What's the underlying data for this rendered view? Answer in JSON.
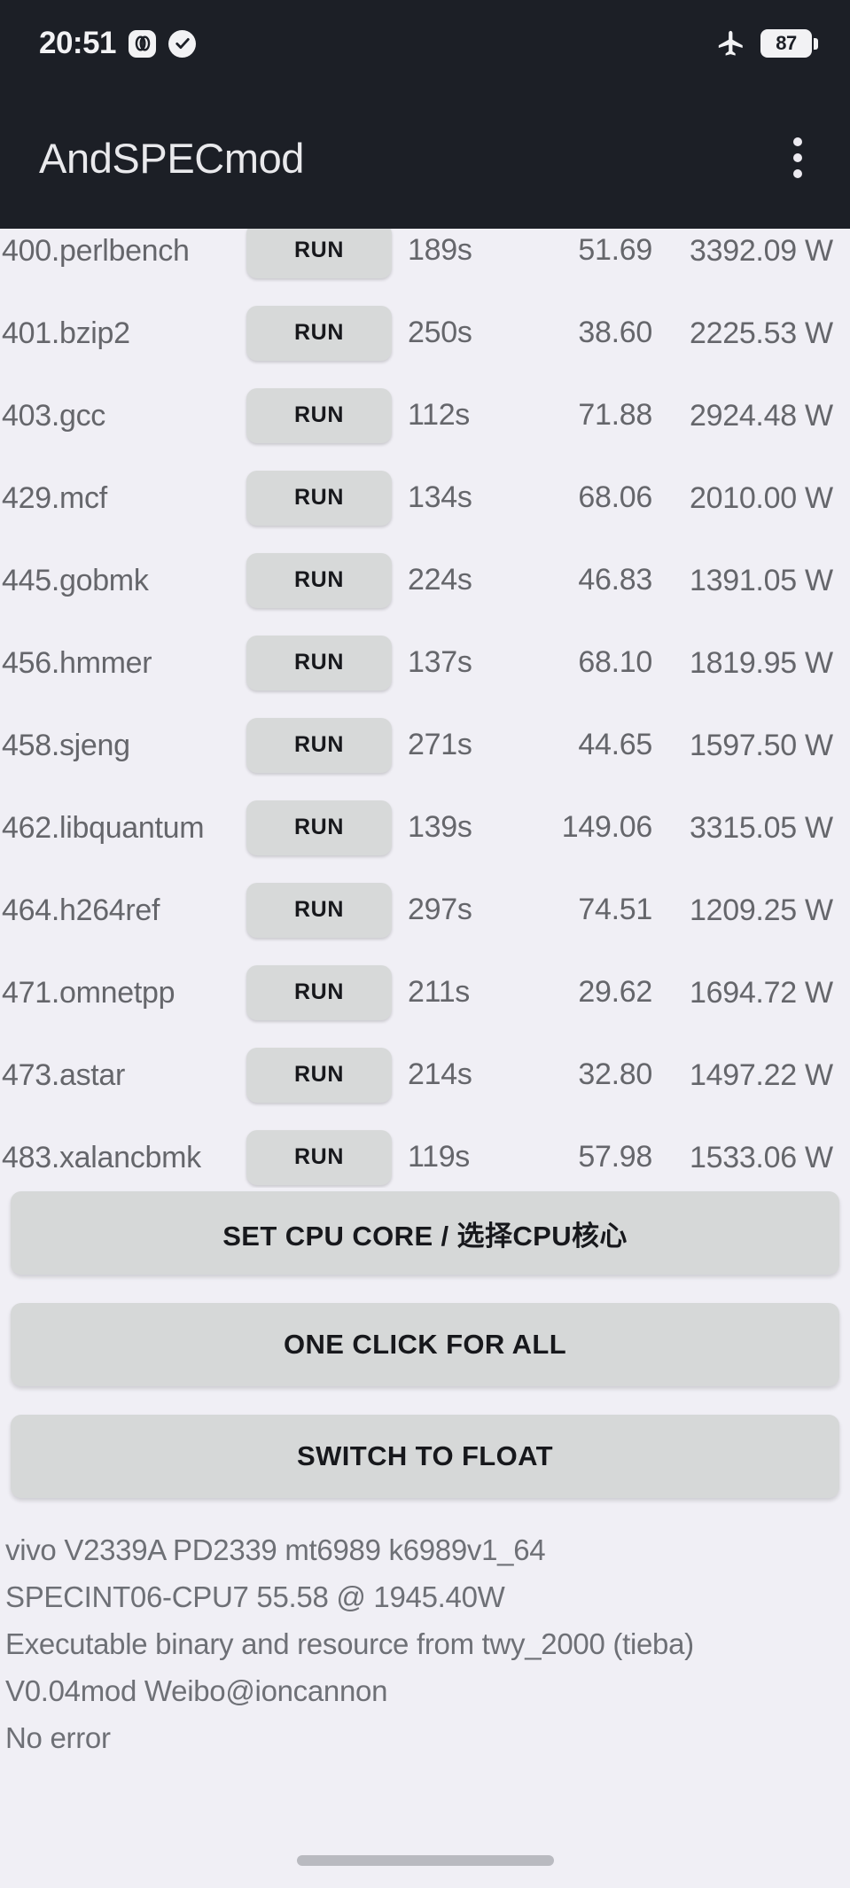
{
  "statusbar": {
    "time": "20:51",
    "icons": [
      "jovi-icon",
      "check-circle-icon",
      "airplane-mode-icon"
    ],
    "battery_level": "87"
  },
  "appbar": {
    "title": "AndSPECmod",
    "overflow_menu": "more-options-icon"
  },
  "table": {
    "run_label": "RUN",
    "rows": [
      {
        "name": "400.perlbench",
        "time": "189s",
        "score": "51.69",
        "power": "3392.09 W"
      },
      {
        "name": "401.bzip2",
        "time": "250s",
        "score": "38.60",
        "power": "2225.53 W"
      },
      {
        "name": "403.gcc",
        "time": "112s",
        "score": "71.88",
        "power": "2924.48 W"
      },
      {
        "name": "429.mcf",
        "time": "134s",
        "score": "68.06",
        "power": "2010.00 W"
      },
      {
        "name": "445.gobmk",
        "time": "224s",
        "score": "46.83",
        "power": "1391.05 W"
      },
      {
        "name": "456.hmmer",
        "time": "137s",
        "score": "68.10",
        "power": "1819.95 W"
      },
      {
        "name": "458.sjeng",
        "time": "271s",
        "score": "44.65",
        "power": "1597.50 W"
      },
      {
        "name": "462.libquantum",
        "time": "139s",
        "score": "149.06",
        "power": "3315.05 W"
      },
      {
        "name": "464.h264ref",
        "time": "297s",
        "score": "74.51",
        "power": "1209.25 W"
      },
      {
        "name": "471.omnetpp",
        "time": "211s",
        "score": "29.62",
        "power": "1694.72 W"
      },
      {
        "name": "473.astar",
        "time": "214s",
        "score": "32.80",
        "power": "1497.22 W"
      },
      {
        "name": "483.xalancbmk",
        "time": "119s",
        "score": "57.98",
        "power": "1533.06 W"
      }
    ]
  },
  "actions": {
    "set_cpu_core": "SET CPU CORE / 选择CPU核心",
    "one_click_for_all": "ONE CLICK FOR ALL",
    "switch_to_float": "SWITCH TO FLOAT"
  },
  "log": {
    "line1": "vivo V2339A PD2339 mt6989 k6989v1_64",
    "line2": "SPECINT06-CPU7  55.58 @ 1945.40W",
    "line3": "Executable binary and resource from twy_2000 (tieba)",
    "line4": "V0.04mod  Weibo@ioncannon",
    "line5": "No error"
  },
  "colors": {
    "appbar_bg": "#1c1f26",
    "page_bg": "#f0eff5",
    "button_bg": "#d6d8d8",
    "text_muted": "#65666b"
  }
}
